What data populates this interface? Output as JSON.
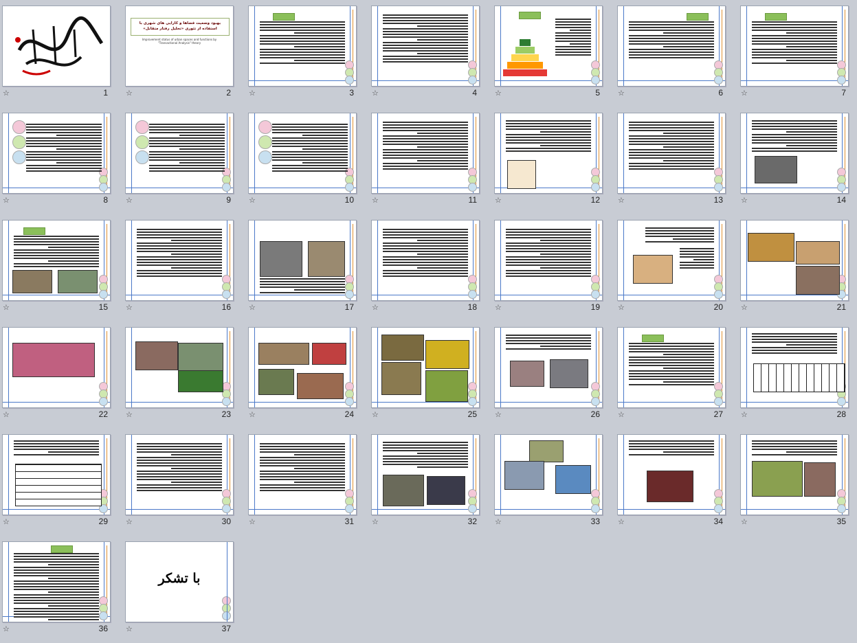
{
  "window": {
    "view": "Slide Sorter"
  },
  "slides": [
    {
      "num": "1",
      "kind": "calligraphy"
    },
    {
      "num": "2",
      "kind": "title",
      "title": "بهبود وضعیت فضاها و کارایی های شهری با استفاده از تئوری «تحلیل رفتار متقابل»",
      "subtitle": "Improvement status of urban spaces and functions by \"Transactional Analysis\" theory"
    },
    {
      "num": "3",
      "kind": "text-tag"
    },
    {
      "num": "4",
      "kind": "text"
    },
    {
      "num": "5",
      "kind": "pyramid"
    },
    {
      "num": "6",
      "kind": "text-tag2"
    },
    {
      "num": "7",
      "kind": "text-tag"
    },
    {
      "num": "8",
      "kind": "text-balls-left"
    },
    {
      "num": "9",
      "kind": "text-balls-left"
    },
    {
      "num": "10",
      "kind": "text-balls-left"
    },
    {
      "num": "11",
      "kind": "text"
    },
    {
      "num": "12",
      "kind": "text-img"
    },
    {
      "num": "13",
      "kind": "text"
    },
    {
      "num": "14",
      "kind": "text-photo"
    },
    {
      "num": "15",
      "kind": "text-tag-photos"
    },
    {
      "num": "16",
      "kind": "text"
    },
    {
      "num": "17",
      "kind": "photos-top"
    },
    {
      "num": "18",
      "kind": "text"
    },
    {
      "num": "19",
      "kind": "text"
    },
    {
      "num": "20",
      "kind": "text-photo-left"
    },
    {
      "num": "21",
      "kind": "collage"
    },
    {
      "num": "22",
      "kind": "collage2"
    },
    {
      "num": "23",
      "kind": "collage3"
    },
    {
      "num": "24",
      "kind": "collage4"
    },
    {
      "num": "25",
      "kind": "collage5"
    },
    {
      "num": "26",
      "kind": "text-photos"
    },
    {
      "num": "27",
      "kind": "text-tag"
    },
    {
      "num": "28",
      "kind": "table"
    },
    {
      "num": "29",
      "kind": "table2"
    },
    {
      "num": "30",
      "kind": "text"
    },
    {
      "num": "31",
      "kind": "text"
    },
    {
      "num": "32",
      "kind": "text-photos2"
    },
    {
      "num": "33",
      "kind": "collage6"
    },
    {
      "num": "34",
      "kind": "text-photo-center"
    },
    {
      "num": "35",
      "kind": "text-photos3"
    },
    {
      "num": "36",
      "kind": "text-dense"
    },
    {
      "num": "37",
      "kind": "thanks",
      "text": "با تشکر"
    }
  ]
}
